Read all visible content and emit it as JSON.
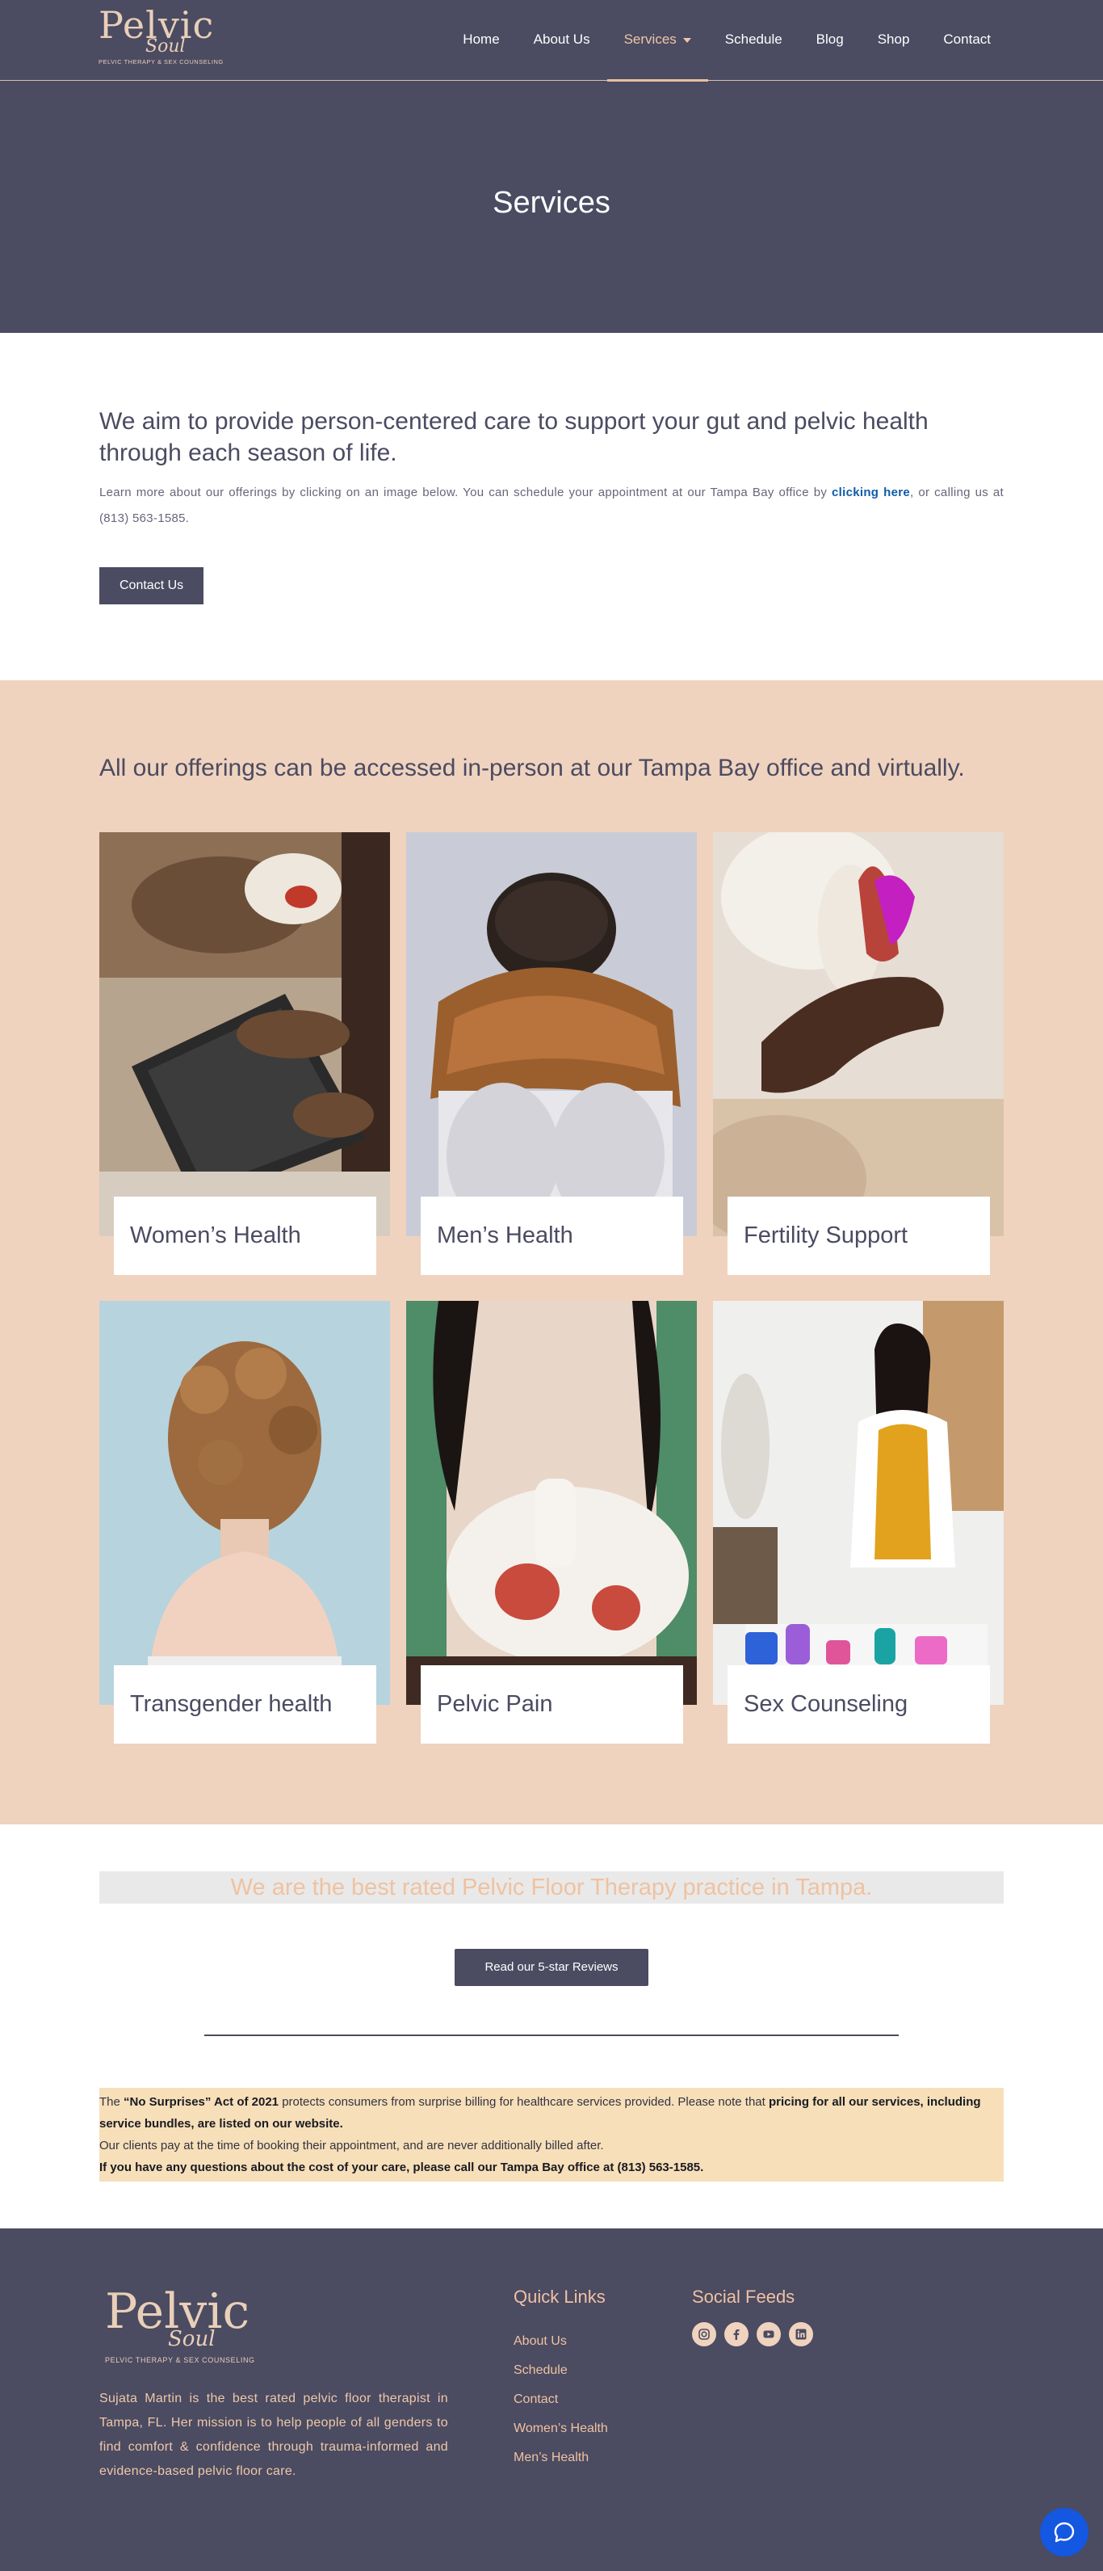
{
  "header": {
    "logo_text": "Pelvic",
    "logo_script": "Soul",
    "logo_tagline": "PELVIC THERAPY & SEX COUNSELING",
    "nav": [
      "Home",
      "About Us",
      "Services",
      "Schedule",
      "Blog",
      "Shop",
      "Contact"
    ],
    "active_nav": "Services"
  },
  "hero": {
    "title": "Services"
  },
  "intro": {
    "heading": "We aim to provide person-centered care to support your gut and pelvic health through each season of life.",
    "body_before_link": "Learn more about our offerings by clicking on an image below. You can schedule your appointment at our Tampa Bay office by ",
    "link_text": "clicking here",
    "body_after_link": ", or calling us at (813) 563-1585.",
    "button_label": "Contact Us"
  },
  "offerings": {
    "heading": "All our offerings can be accessed in-person at our Tampa Bay office and virtually.",
    "cards": [
      {
        "label": "Women’s Health"
      },
      {
        "label": "Men’s Health"
      },
      {
        "label": "Fertility Support"
      },
      {
        "label": "Transgender health"
      },
      {
        "label": "Pelvic Pain"
      },
      {
        "label": "Sex Counseling"
      }
    ]
  },
  "reviews": {
    "banner": "We are the best rated Pelvic Floor Therapy practice in Tampa.",
    "button_label": "Read our 5-star Reviews"
  },
  "notice": {
    "p1_a": "The ",
    "p1_b": "“No Surprises” Act of 2021",
    "p1_c": " protects consumers from surprise billing for healthcare services provided. Please note that ",
    "p1_d": "pricing for all our services, including service bundles, are listed on our website.",
    "p2": "Our clients pay at the time of booking their appointment, and are never additionally billed after.",
    "p3": "If you have any questions about the cost of your care, please call our Tampa Bay office at (813) 563-1585."
  },
  "footer": {
    "about": "Sujata Martin is the best rated pelvic floor therapist in Tampa, FL. Her mission is to help people of all genders to find comfort & confidence through trauma-informed and evidence-based pelvic floor care.",
    "quick_links_title": "Quick Links",
    "quick_links": [
      "About Us",
      "Schedule",
      "Contact",
      "Women’s Health",
      "Men’s Health"
    ],
    "social_title": "Social Feeds",
    "social_icons": [
      "instagram-icon",
      "facebook-icon",
      "youtube-icon",
      "linkedin-icon"
    ]
  },
  "colors": {
    "navy": "#4b4b62",
    "peach": "#efd3be",
    "accent": "#efc2a0",
    "notice_bg": "#f7dfb9",
    "link_blue": "#0f5ba8",
    "chat_blue": "#1457e0"
  }
}
